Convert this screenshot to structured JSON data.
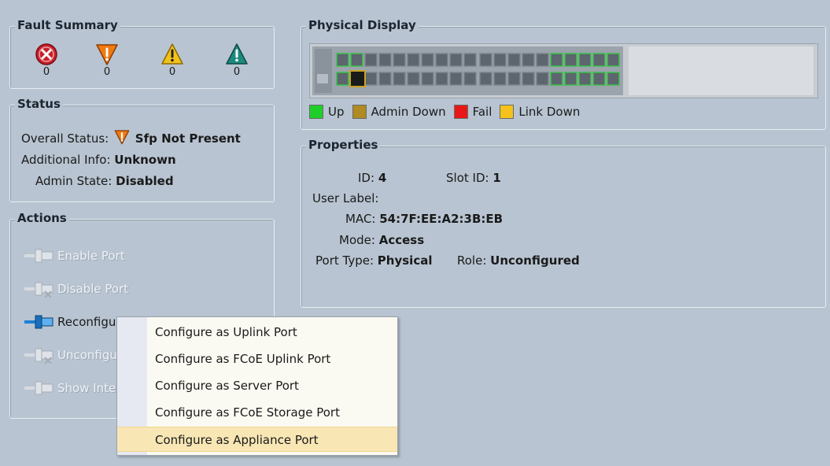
{
  "fault_summary": {
    "title": "Fault Summary",
    "items": [
      {
        "name": "critical",
        "count": "0",
        "color": "#c8202a"
      },
      {
        "name": "major",
        "count": "0",
        "color": "#f07a10"
      },
      {
        "name": "minor",
        "count": "0",
        "color": "#f2c21a"
      },
      {
        "name": "warning",
        "count": "0",
        "color": "#1e8a7e"
      }
    ]
  },
  "status": {
    "title": "Status",
    "overall_label": "Overall Status:",
    "overall_value": "Sfp Not Present",
    "additional_label": "Additional Info:",
    "additional_value": "Unknown",
    "admin_label": "Admin State:",
    "admin_value": "Disabled"
  },
  "actions": {
    "title": "Actions",
    "items": [
      {
        "label": "Enable Port",
        "enabled": false
      },
      {
        "label": "Disable Port",
        "enabled": false
      },
      {
        "label": "Reconfigur",
        "enabled": true
      },
      {
        "label": "Unconfigur",
        "enabled": false
      },
      {
        "label": "Show Inter",
        "enabled": false
      }
    ]
  },
  "physical_display": {
    "title": "Physical Display",
    "legend": [
      {
        "label": "Up",
        "color": "#1ecf2a"
      },
      {
        "label": "Admin Down",
        "color": "#b08a22"
      },
      {
        "label": "Fail",
        "color": "#e81818"
      },
      {
        "label": "Link Down",
        "color": "#f4c21a"
      }
    ]
  },
  "properties": {
    "title": "Properties",
    "id_label": "ID:",
    "id_value": "4",
    "slot_label": "Slot ID:",
    "slot_value": "1",
    "user_label_label": "User Label:",
    "user_label_value": "",
    "mac_label": "MAC:",
    "mac_value": "54:7F:EE:A2:3B:EB",
    "mode_label": "Mode:",
    "mode_value": "Access",
    "port_type_label": "Port Type:",
    "port_type_value": "Physical",
    "role_label": "Role:",
    "role_value": "Unconfigured"
  },
  "context_menu": {
    "items": [
      {
        "label": "Configure as Uplink Port"
      },
      {
        "label": "Configure as FCoE Uplink Port"
      },
      {
        "label": "Configure as Server Port"
      },
      {
        "label": "Configure as FCoE Storage Port"
      },
      {
        "label": "Configure as Appliance Port",
        "highlighted": true
      }
    ]
  }
}
